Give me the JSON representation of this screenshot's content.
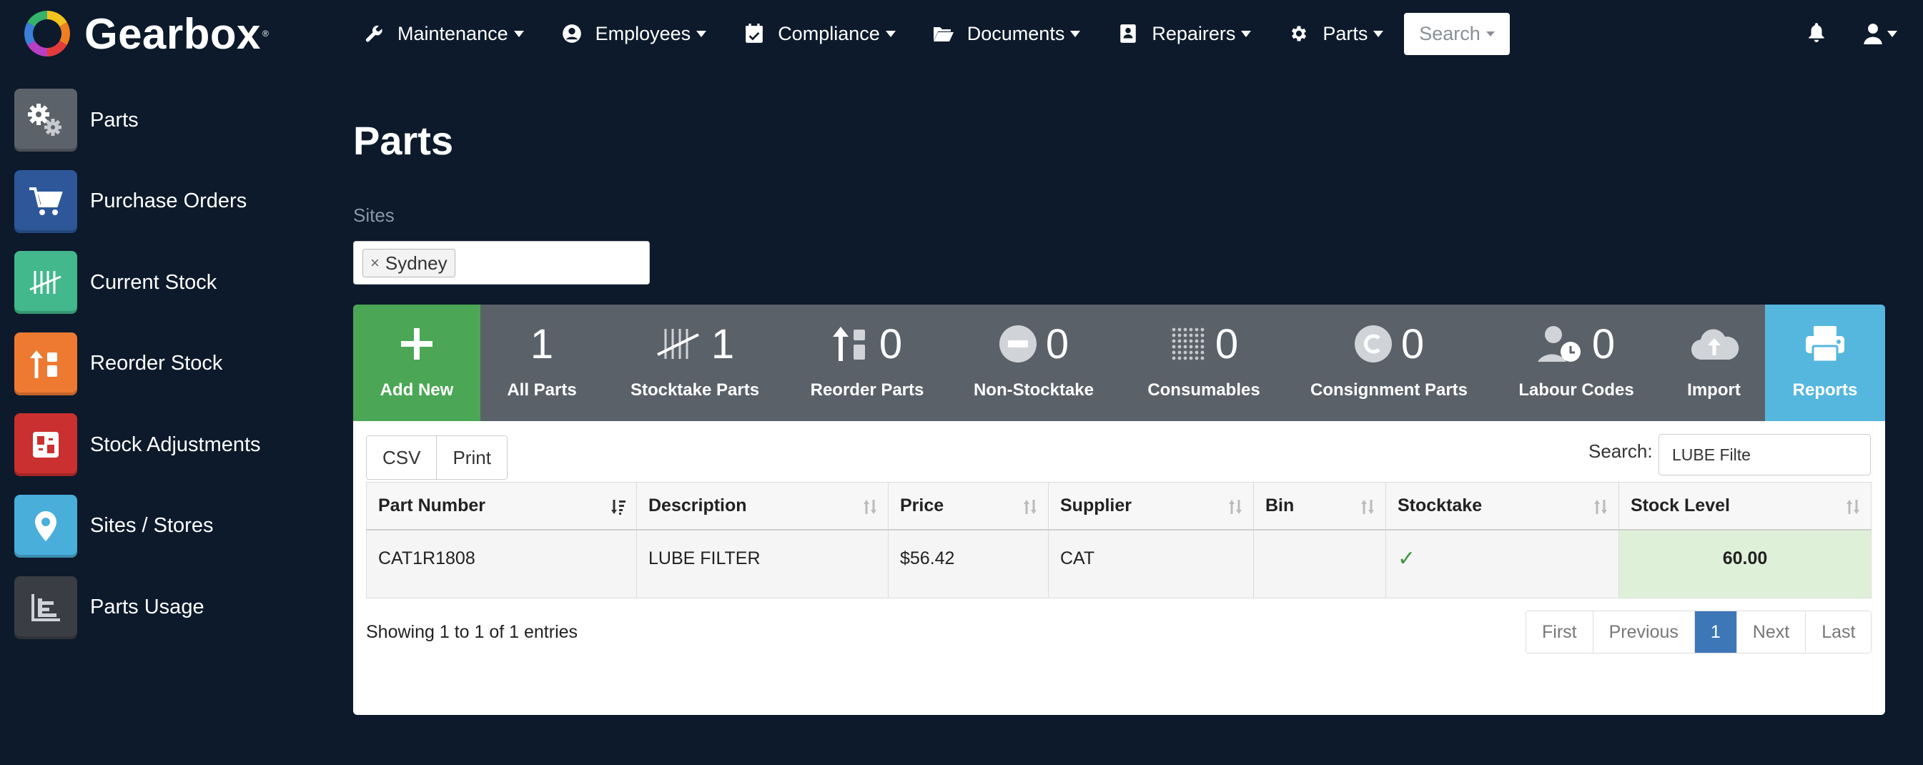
{
  "brand": {
    "name": "Gearbox",
    "reg": "®"
  },
  "navbar": {
    "items": [
      {
        "label": "Maintenance",
        "icon": "wrench-icon"
      },
      {
        "label": "Employees",
        "icon": "person-circle-icon"
      },
      {
        "label": "Compliance",
        "icon": "calendar-check-icon"
      },
      {
        "label": "Documents",
        "icon": "folder-open-icon"
      },
      {
        "label": "Repairers",
        "icon": "contact-card-icon"
      },
      {
        "label": "Parts",
        "icon": "gear-icon"
      }
    ],
    "search_label": "Search",
    "bell_icon": "bell-icon",
    "user_icon": "user-icon"
  },
  "sidebar": {
    "items": [
      {
        "label": "Parts",
        "icon": "gears-icon",
        "color": "#5c6269"
      },
      {
        "label": "Purchase Orders",
        "icon": "cart-icon",
        "color": "#2d5799"
      },
      {
        "label": "Current Stock",
        "icon": "tally-icon",
        "color": "#43b88d"
      },
      {
        "label": "Reorder Stock",
        "icon": "reorder-icon",
        "color": "#ee7a32"
      },
      {
        "label": "Stock Adjustments",
        "icon": "adjust-icon",
        "color": "#c9302f"
      },
      {
        "label": "Sites / Stores",
        "icon": "map-pin-icon",
        "color": "#4aaedb"
      },
      {
        "label": "Parts Usage",
        "icon": "bar-chart-icon",
        "color": "#3a3e44"
      }
    ]
  },
  "page": {
    "title": "Parts",
    "sites_label": "Sites",
    "site_tag": "Sydney",
    "site_tag_remove": "×"
  },
  "tiles": [
    {
      "label": "Add New",
      "count": "",
      "icon": "plus-icon"
    },
    {
      "label": "All Parts",
      "count": "1",
      "icon": ""
    },
    {
      "label": "Stocktake Parts",
      "count": "1",
      "icon": "tally-icon"
    },
    {
      "label": "Reorder Parts",
      "count": "0",
      "icon": "reorder-icon"
    },
    {
      "label": "Non-Stocktake",
      "count": "0",
      "icon": "minus-circle-icon"
    },
    {
      "label": "Consumables",
      "count": "0",
      "icon": "dot-grid-icon"
    },
    {
      "label": "Consignment Parts",
      "count": "0",
      "icon": "c-circle-icon"
    },
    {
      "label": "Labour Codes",
      "count": "0",
      "icon": "user-clock-icon"
    },
    {
      "label": "Import",
      "count": "",
      "icon": "cloud-upload-icon"
    },
    {
      "label": "Reports",
      "count": "",
      "icon": "printer-icon"
    }
  ],
  "table": {
    "buttons": [
      "CSV",
      "Print"
    ],
    "search_label": "Search:",
    "search_value": "LUBE Filte",
    "columns": [
      "Part Number",
      "Description",
      "Price",
      "Supplier",
      "Bin",
      "Stocktake",
      "Stock Level"
    ],
    "rows": [
      {
        "part_number": "CAT1R1808",
        "description": "LUBE FILTER",
        "price": "$56.42",
        "supplier": "CAT",
        "bin": "",
        "stocktake": "✓",
        "stock_level": "60.00"
      }
    ],
    "info": "Showing 1 to 1 of 1 entries",
    "pager": [
      "First",
      "Previous",
      "1",
      "Next",
      "Last"
    ]
  },
  "colors": {
    "background": "#0c1a2b",
    "tiles_bar": "#5b6169",
    "add_new": "#4ba755",
    "reports": "#55b7de",
    "stock_level_cell": "#dff0d8",
    "pager_active": "#3d77b8",
    "check": "#3c9a3c"
  }
}
